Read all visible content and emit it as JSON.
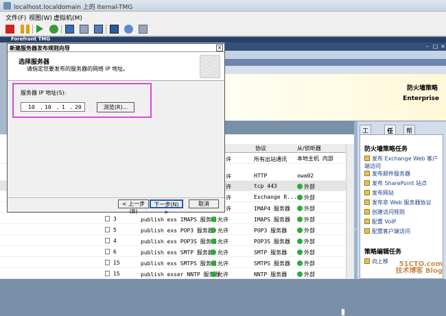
{
  "window": {
    "title": "localhost.localdomain 上的 Iternal-TMG"
  },
  "menu": {
    "file": "文件(F)",
    "view": "视图(W)",
    "vm": "虚拟机(M)"
  },
  "colors": {
    "accent": "#d44bd8",
    "header": "#2a3f65"
  },
  "console": {
    "header_title": "Forefront TMG",
    "policy_title": "防火墙策略",
    "edition": "Enterprise"
  },
  "right_panel": {
    "tabs": [
      "工具箱",
      "任务",
      "帮助"
    ],
    "heading": "防火墙策略任务",
    "tasks": [
      "发布 Exchange Web 客户端访问",
      "发布邮件服务器",
      "发布 SharePoint 站点",
      "发布网站",
      "发布非 Web 服务器协议",
      "创建访问规则",
      "配置 VoIP",
      "配置客户端访问"
    ],
    "footer_heading": "策略编辑任务",
    "footer_item": "向上移"
  },
  "table": {
    "columns": [
      "协议",
      "从/侦听器"
    ],
    "rows": [
      {
        "num": "",
        "name": "",
        "action": "许",
        "protocol": "所有出站通讯",
        "from": "本地主机 内部"
      },
      {
        "num": "",
        "name": "",
        "action": "许",
        "protocol": "HTTP",
        "from": "owa02"
      },
      {
        "num": "",
        "name": "",
        "action": "许",
        "protocol": "tcp 443",
        "from": "外部"
      },
      {
        "num": "",
        "name": "",
        "action": "许",
        "protocol": "Exchange R...",
        "from": "外部"
      },
      {
        "num": "",
        "name": "",
        "action": "许",
        "protocol": "IMAP4 服务器",
        "from": "外部"
      },
      {
        "num": "3",
        "name": "publish exs IMAPS 服务器",
        "action": "允许",
        "protocol": "IMAPS 服务器",
        "from": "外部"
      },
      {
        "num": "5",
        "name": "publish exs POP3 服务器",
        "action": "允许",
        "protocol": "POP3 服务器",
        "from": "外部"
      },
      {
        "num": "4",
        "name": "publish exs POP3S 服务器",
        "action": "允许",
        "protocol": "POP3S 服务器",
        "from": "外部"
      },
      {
        "num": "6",
        "name": "publish exs SMTP 服务器",
        "action": "允许",
        "protocol": "SMTP 服务器",
        "from": "外部"
      },
      {
        "num": "15",
        "name": "publish exs SMTPS 服务器",
        "action": "允许",
        "protocol": "SMTPS 服务器",
        "from": "外部"
      },
      {
        "num": "15",
        "name": "publish exser NNTP 服务器",
        "action": "允许",
        "protocol": "NNTP 服务器",
        "from": "外部"
      }
    ]
  },
  "dialog": {
    "title": "新建服务器发布规则向导",
    "heading": "选择服务器",
    "subheading": "请指定您要发布的服务器的网络 IP 地址。",
    "ip_label": "服务器 IP 地址(S):",
    "ip": {
      "a": "10",
      "b": "10",
      "c": "1",
      "d": "20"
    },
    "browse": "浏览(R)...",
    "back": "< 上一步(B)",
    "next": "下一步(N) >",
    "cancel": "取消"
  },
  "watermark": {
    "line1": "51CTO.com",
    "line2": "技术博客 Blog"
  }
}
